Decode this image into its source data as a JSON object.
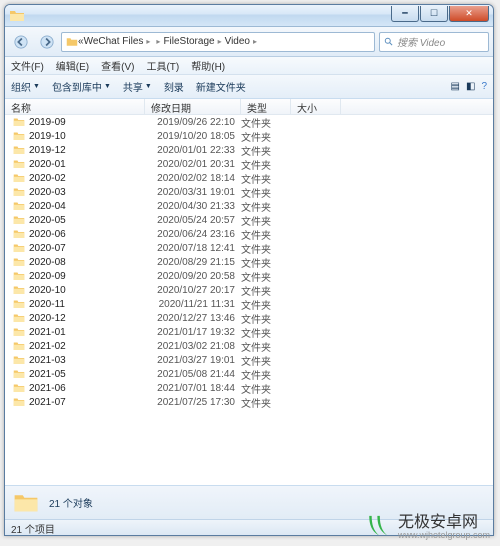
{
  "breadcrumbs": {
    "a": "«",
    "b": "WeChat Files",
    "c": "",
    "d": "FileStorage",
    "e": "Video"
  },
  "search": {
    "placeholder": "搜索 Video"
  },
  "menu": {
    "file": "文件(F)",
    "edit": "编辑(E)",
    "view": "查看(V)",
    "tools": "工具(T)",
    "help": "帮助(H)"
  },
  "toolbar": {
    "organize": "组织",
    "include": "包含到库中",
    "share": "共享",
    "slideshow": "刻录",
    "newfolder": "新建文件夹"
  },
  "columns": {
    "name": "名称",
    "date": "修改日期",
    "type": "类型",
    "size": "大小"
  },
  "files": [
    {
      "name": "2019-09",
      "date": "2019/09/26 22:10",
      "type": "文件夹"
    },
    {
      "name": "2019-10",
      "date": "2019/10/20 18:05",
      "type": "文件夹"
    },
    {
      "name": "2019-12",
      "date": "2020/01/01 22:33",
      "type": "文件夹"
    },
    {
      "name": "2020-01",
      "date": "2020/02/01 20:31",
      "type": "文件夹"
    },
    {
      "name": "2020-02",
      "date": "2020/02/02 18:14",
      "type": "文件夹"
    },
    {
      "name": "2020-03",
      "date": "2020/03/31 19:01",
      "type": "文件夹"
    },
    {
      "name": "2020-04",
      "date": "2020/04/30 21:33",
      "type": "文件夹"
    },
    {
      "name": "2020-05",
      "date": "2020/05/24 20:57",
      "type": "文件夹"
    },
    {
      "name": "2020-06",
      "date": "2020/06/24 23:16",
      "type": "文件夹"
    },
    {
      "name": "2020-07",
      "date": "2020/07/18 12:41",
      "type": "文件夹"
    },
    {
      "name": "2020-08",
      "date": "2020/08/29 21:15",
      "type": "文件夹"
    },
    {
      "name": "2020-09",
      "date": "2020/09/20 20:58",
      "type": "文件夹"
    },
    {
      "name": "2020-10",
      "date": "2020/10/27 20:17",
      "type": "文件夹"
    },
    {
      "name": "2020-11",
      "date": "2020/11/21 11:31",
      "type": "文件夹"
    },
    {
      "name": "2020-12",
      "date": "2020/12/27 13:46",
      "type": "文件夹"
    },
    {
      "name": "2021-01",
      "date": "2021/01/17 19:32",
      "type": "文件夹"
    },
    {
      "name": "2021-02",
      "date": "2021/03/02 21:08",
      "type": "文件夹"
    },
    {
      "name": "2021-03",
      "date": "2021/03/27 19:01",
      "type": "文件夹"
    },
    {
      "name": "2021-05",
      "date": "2021/05/08 21:44",
      "type": "文件夹"
    },
    {
      "name": "2021-06",
      "date": "2021/07/01 18:44",
      "type": "文件夹"
    },
    {
      "name": "2021-07",
      "date": "2021/07/25 17:30",
      "type": "文件夹"
    }
  ],
  "detail": {
    "text": "21 个对象"
  },
  "status": {
    "text": "21 个项目"
  },
  "watermark": {
    "title": "无极安卓网",
    "url": "www.wjhotelgroup.com"
  }
}
